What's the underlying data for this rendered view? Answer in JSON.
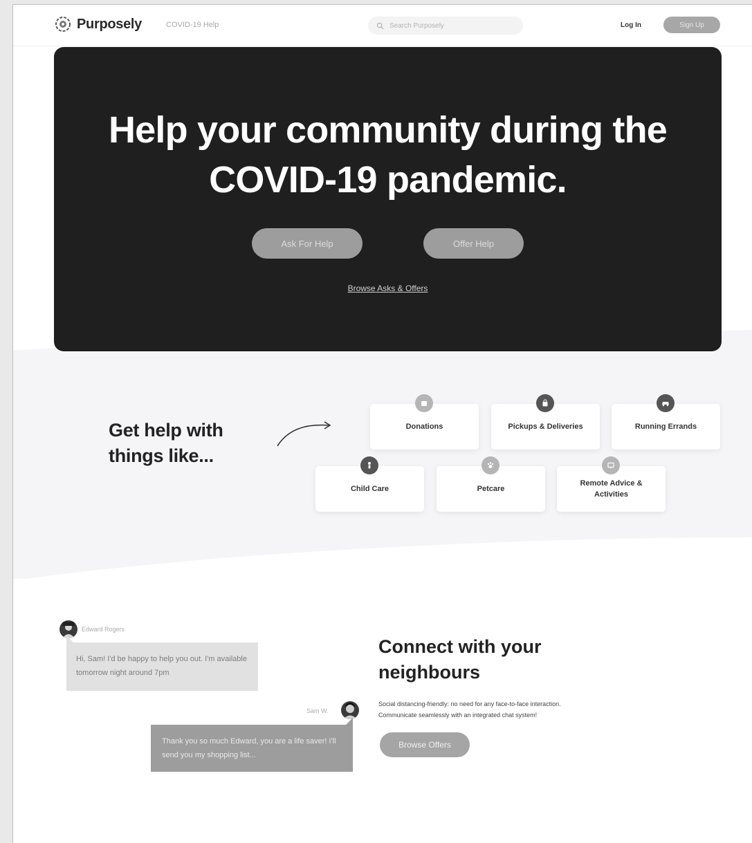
{
  "header": {
    "brand": "Purposely",
    "nav_link": "COVID-19 Help",
    "search_placeholder": "Search Purposely",
    "login": "Log In",
    "signup": "Sign Up"
  },
  "hero": {
    "title_line1": "Help your community during the",
    "title_line2": "COVID-19 pandemic.",
    "ask_button": "Ask For Help",
    "offer_button": "Offer Help",
    "browse_link": "Browse Asks & Offers"
  },
  "help": {
    "heading_line1": "Get help with",
    "heading_line2": "things like...",
    "categories": [
      {
        "label": "Donations",
        "icon": "donation-icon"
      },
      {
        "label": "Pickups & Deliveries",
        "icon": "bag-icon"
      },
      {
        "label": "Running Errands",
        "icon": "car-icon"
      },
      {
        "label": "Child Care",
        "icon": "child-icon"
      },
      {
        "label": "Petcare",
        "icon": "paw-icon"
      },
      {
        "label": "Remote Advice & Activities",
        "icon": "monitor-icon"
      }
    ]
  },
  "chat": {
    "sender1": "Edward Rogers",
    "message1": "Hi, Sam! I'd be happy to help you out. I'm available tomorrow night around 7pm",
    "sender2": "Sam W.",
    "message2": "Thank you so much Edward, you are a life saver! I'll send you my shopping list..."
  },
  "connect": {
    "heading_line1": "Connect with your",
    "heading_line2": "neighbours",
    "desc_line1": "Social distancing-friendly: no need for any face-to-face interaction.",
    "desc_line2": "Communicate seamlessly with an integrated chat system!",
    "button": "Browse Offers"
  }
}
